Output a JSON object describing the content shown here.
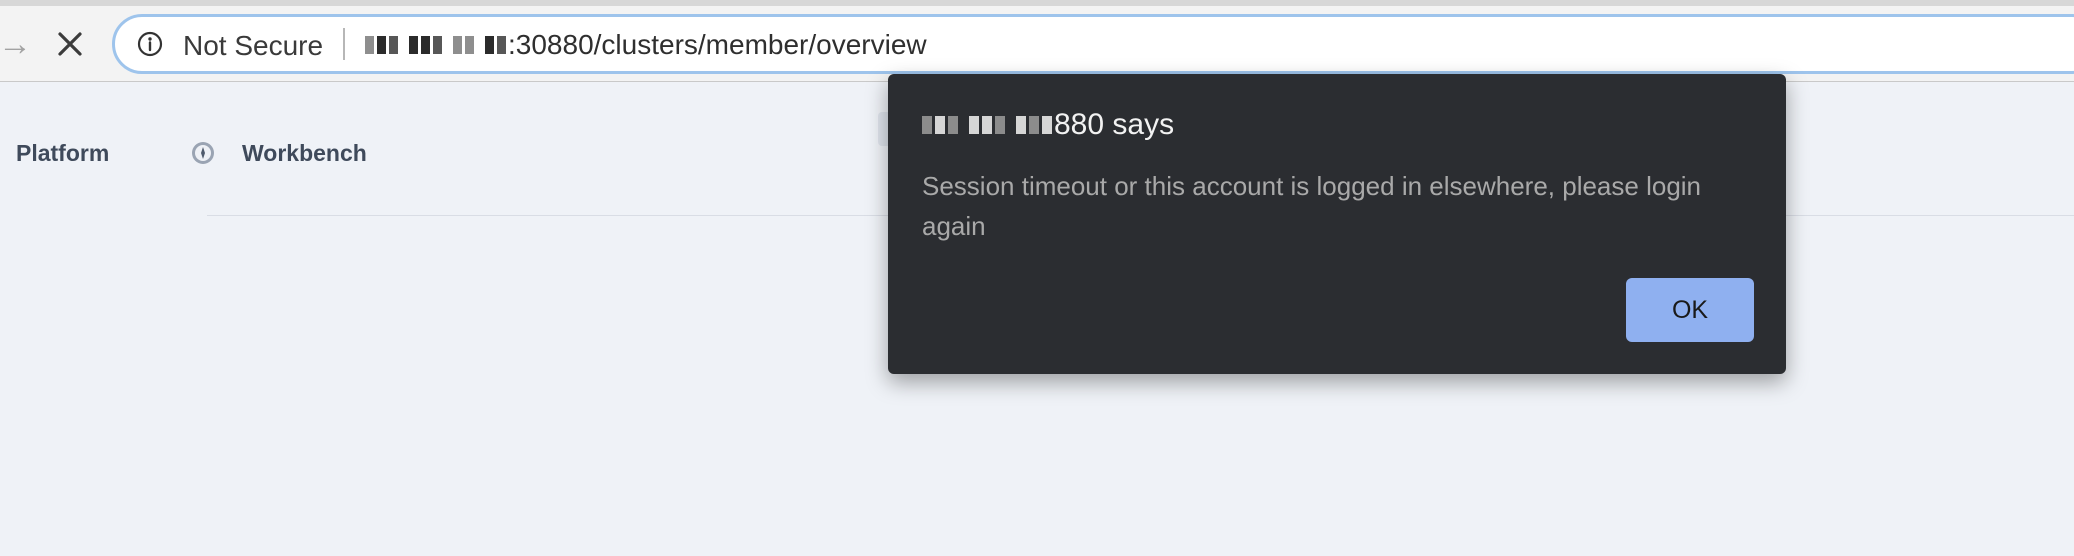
{
  "browser": {
    "security_label": "Not Secure",
    "url_suffix": ":30880/clusters/member/overview"
  },
  "nav": {
    "items": [
      {
        "label": "Platform"
      },
      {
        "label": "Workbench"
      }
    ]
  },
  "dialog": {
    "title_suffix": "880 says",
    "message": "Session timeout or this account is logged in elsewhere, please login again",
    "ok_label": "OK"
  },
  "colors": {
    "dialog_bg": "#2b2d31",
    "ok_button": "#8fb0f0",
    "page_bg": "#eff2f7",
    "address_focus": "#9ec4ec"
  },
  "icons": {
    "forward": "arrow-right-icon",
    "stop": "close-icon",
    "info": "info-icon",
    "workbench": "compass-icon"
  }
}
